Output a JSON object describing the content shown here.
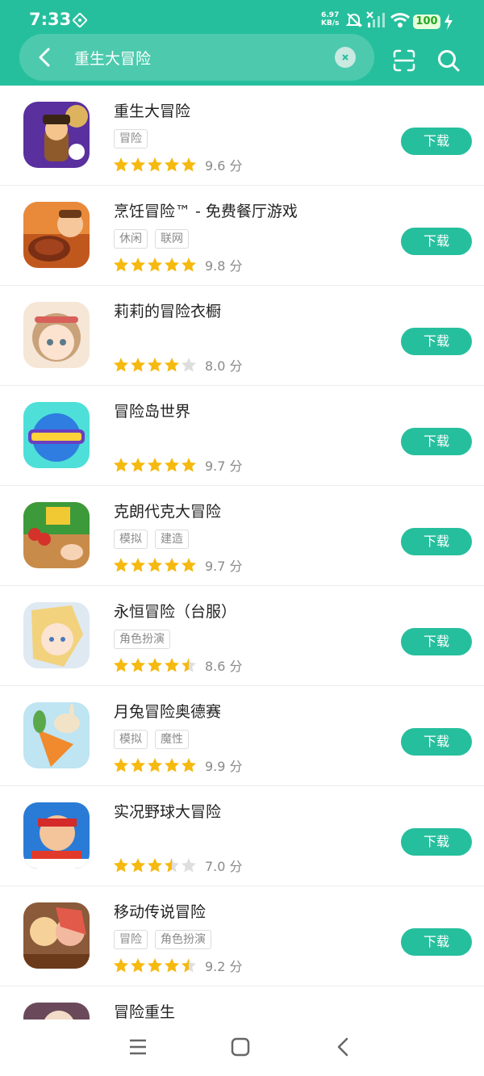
{
  "status": {
    "time": "7:33",
    "net_speed": "6.97",
    "net_unit": "KB/s",
    "battery": "100"
  },
  "search": {
    "query": "重生大冒险"
  },
  "apps": [
    {
      "name": "重生大冒险",
      "tags": [
        "冒险"
      ],
      "stars": 5,
      "score": "9.6 分",
      "button": "下载"
    },
    {
      "name": "烹饪冒险™ - 免费餐厅游戏",
      "tags": [
        "休闲",
        "联网"
      ],
      "stars": 5,
      "score": "9.8 分",
      "button": "下载"
    },
    {
      "name": "莉莉的冒险衣橱",
      "tags": [],
      "stars": 4,
      "score": "8.0 分",
      "button": "下载"
    },
    {
      "name": "冒险岛世界",
      "tags": [],
      "stars": 5,
      "score": "9.7 分",
      "button": "下载"
    },
    {
      "name": "克朗代克大冒险",
      "tags": [
        "模拟",
        "建造"
      ],
      "stars": 5,
      "score": "9.7 分",
      "button": "下载"
    },
    {
      "name": "永恒冒险（台服）",
      "tags": [
        "角色扮演"
      ],
      "stars": 4.5,
      "score": "8.6 分",
      "button": "下载"
    },
    {
      "name": "月兔冒险奥德赛",
      "tags": [
        "模拟",
        "魔性"
      ],
      "stars": 5,
      "score": "9.9 分",
      "button": "下载"
    },
    {
      "name": "实况野球大冒险",
      "tags": [],
      "stars": 3.5,
      "score": "7.0 分",
      "button": "下载"
    },
    {
      "name": "移动传说冒险",
      "tags": [
        "冒险",
        "角色扮演"
      ],
      "stars": 4.5,
      "score": "9.2 分",
      "button": "下载"
    },
    {
      "name": "冒险重生",
      "tags": [],
      "stars": 0,
      "score": "",
      "button": ""
    }
  ],
  "icons": {
    "back": "back-arrow-icon",
    "clear": "clear-icon",
    "scan": "scan-icon",
    "search": "search-icon",
    "nav_menu": "menu-icon",
    "nav_home": "home-icon",
    "nav_back": "back-icon",
    "star": "star-icon"
  },
  "colors": {
    "accent": "#26bf9d",
    "star": "#f5b90f",
    "star_empty": "#dedede"
  }
}
